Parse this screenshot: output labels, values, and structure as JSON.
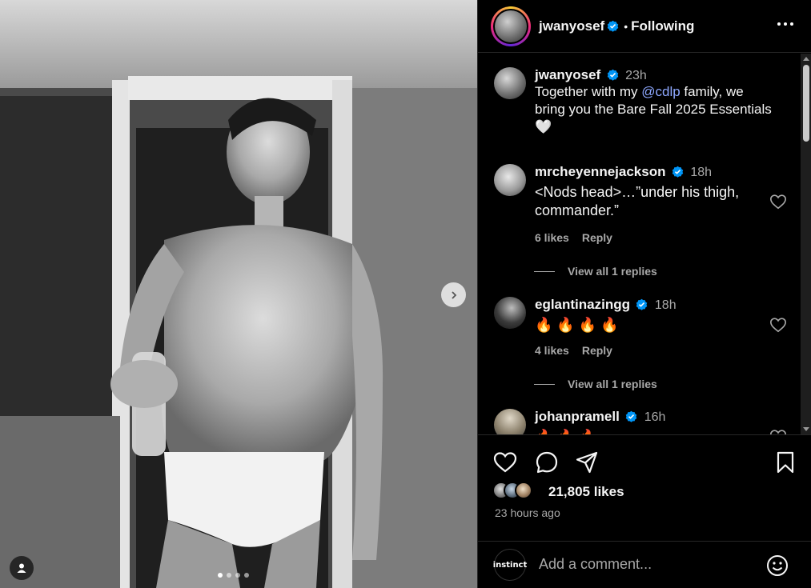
{
  "post": {
    "author": "jwanyosef",
    "follow_state": "Following",
    "caption_author": "jwanyosef",
    "caption_time": "23h",
    "caption_prefix": "Together with my ",
    "caption_mention": "@cdlp",
    "caption_suffix": " family, we bring you the Bare Fall 2025 Essentials",
    "caption_emoji": "🤍",
    "likes": "21,805 likes",
    "posted_ago": "23 hours ago",
    "carousel_total": 4,
    "carousel_active": 1
  },
  "comments": [
    {
      "username": "mrcheyennejackson",
      "time": "18h",
      "text": "<Nods head>…”under his thigh, commander.”",
      "likes": "6 likes",
      "reply": "Reply",
      "view_replies": "View all 1 replies"
    },
    {
      "username": "eglantinazingg",
      "time": "18h",
      "text": "🔥 🔥 🔥 🔥",
      "likes": "4 likes",
      "reply": "Reply",
      "view_replies": "View all 1 replies"
    },
    {
      "username": "johanpramell",
      "time": "16h",
      "text": "🔥 🔥 🔥"
    }
  ],
  "composer": {
    "placeholder": "Add a comment...",
    "avatar_label": "instinct"
  },
  "colors": {
    "accent": "#0095f6",
    "mention": "#8ea8ff",
    "muted": "#a8a8a8",
    "fire": "#ff5a1f"
  },
  "icons": [
    "verified-badge-icon",
    "more-icon",
    "heart-icon",
    "comment-icon",
    "share-icon",
    "bookmark-icon",
    "emoji-icon",
    "chevron-right-icon",
    "user-tag-icon"
  ]
}
